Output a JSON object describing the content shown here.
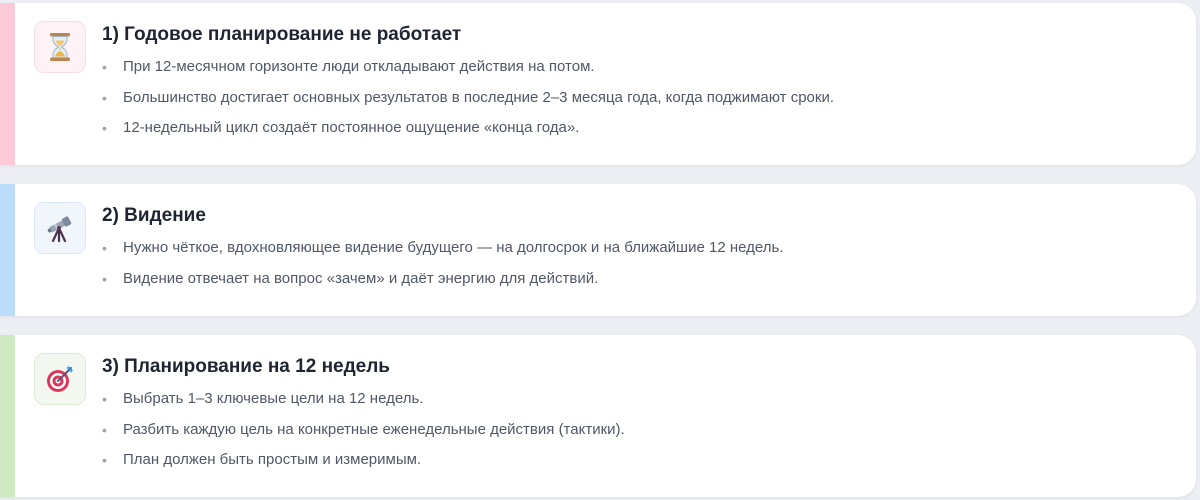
{
  "colors": {
    "page_bg": "#eceef3",
    "card_bg": "#ffffff",
    "accent_pink": "#fcc9d8",
    "accent_blue": "#bcdcfb",
    "accent_green": "#cfe9c3",
    "title_text": "#1e2430",
    "body_text": "#505866"
  },
  "sections": [
    {
      "title": "1) Годовое планирование не работает",
      "icon": "hourglass-icon",
      "bullet_glyph": "•",
      "bullets": [
        "При 12-месячном горизонте люди откладывают действия на потом.",
        "Большинство достигает основных результатов в последние 2–3 месяца года, когда поджимают сроки.",
        "12-недельный цикл создаёт постоянное ощущение «конца года»."
      ]
    },
    {
      "title": "2) Видение",
      "icon": "telescope-icon",
      "bullet_glyph": "•",
      "bullets": [
        "Нужно чёткое, вдохновляющее видение будущего — на долгосрок и на ближайшие 12 недель.",
        "Видение отвечает на вопрос «зачем» и даёт энергию для действий."
      ]
    },
    {
      "title": "3) Планирование на 12 недель",
      "icon": "target-icon",
      "bullet_glyph": "•",
      "bullets": [
        "Выбрать 1–3 ключевые цели на 12 недель.",
        "Разбить каждую цель на конкретные еженедельные действия (тактики).",
        "План должен быть простым и измеримым."
      ]
    }
  ]
}
